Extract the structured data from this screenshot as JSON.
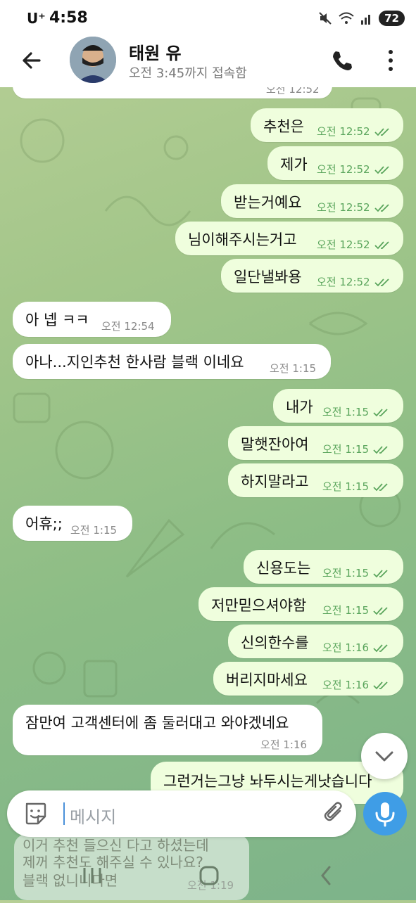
{
  "status_bar": {
    "carrier": "U⁺",
    "time": "4:58",
    "battery": "72"
  },
  "header": {
    "name": "태원 유",
    "status": "오전 3:45까지 접속함"
  },
  "messages": [
    {
      "dir": "in",
      "text": "",
      "time": "오전 12:52"
    },
    {
      "dir": "out",
      "text": "추천은",
      "time": "오전 12:52"
    },
    {
      "dir": "out",
      "text": "제가",
      "time": "오전 12:52"
    },
    {
      "dir": "out",
      "text": "받는거예요",
      "time": "오전 12:52"
    },
    {
      "dir": "out",
      "text": "님이해주시는거고",
      "time": "오전 12:52"
    },
    {
      "dir": "out",
      "text": "일단낼봐용",
      "time": "오전 12:52"
    },
    {
      "dir": "in",
      "text": "아 넵 ㅋㅋ",
      "time": "오전 12:54"
    },
    {
      "dir": "in",
      "text": "아나...지인추천 한사람 블랙 이네요",
      "time": "오전 1:15"
    },
    {
      "dir": "out",
      "text": "내가",
      "time": "오전 1:15"
    },
    {
      "dir": "out",
      "text": "말햇잔아여",
      "time": "오전 1:15"
    },
    {
      "dir": "out",
      "text": "하지말라고",
      "time": "오전 1:15"
    },
    {
      "dir": "in",
      "text": "어휴;;",
      "time": "오전 1:15"
    },
    {
      "dir": "out",
      "text": "신용도는",
      "time": "오전 1:15"
    },
    {
      "dir": "out",
      "text": "저만믿으셔야함",
      "time": "오전 1:15"
    },
    {
      "dir": "out",
      "text": "신의한수를",
      "time": "오전 1:16"
    },
    {
      "dir": "out",
      "text": "버리지마세요",
      "time": "오전 1:16"
    },
    {
      "dir": "in",
      "text": "잠만여 고객센터에 좀 둘러대고 와야겠네요",
      "time": "오전 1:16"
    },
    {
      "dir": "out",
      "text": "그런거는그냥 놔두시는게낫습니다",
      "time": ""
    }
  ],
  "composer": {
    "placeholder": "메시지"
  },
  "reply_preview": {
    "line1": "이거 추천 들으신 다고 하셨는데",
    "line2": "제꺼 추천도 해주실 수 있나요?",
    "line3": "블랙 없니니다면",
    "time": "오전 1:19"
  },
  "icons": {
    "back": "arrow-left-icon",
    "call": "phone-icon",
    "more": "more-vertical-icon",
    "sticker": "sticker-icon",
    "attach": "paperclip-icon",
    "mic": "microphone-icon",
    "scroll": "chevron-down-icon"
  },
  "colors": {
    "outgoing_bubble": "#effedd",
    "incoming_bubble": "#ffffff",
    "read_check": "#5aa55c",
    "mic_button": "#3f9de6"
  }
}
